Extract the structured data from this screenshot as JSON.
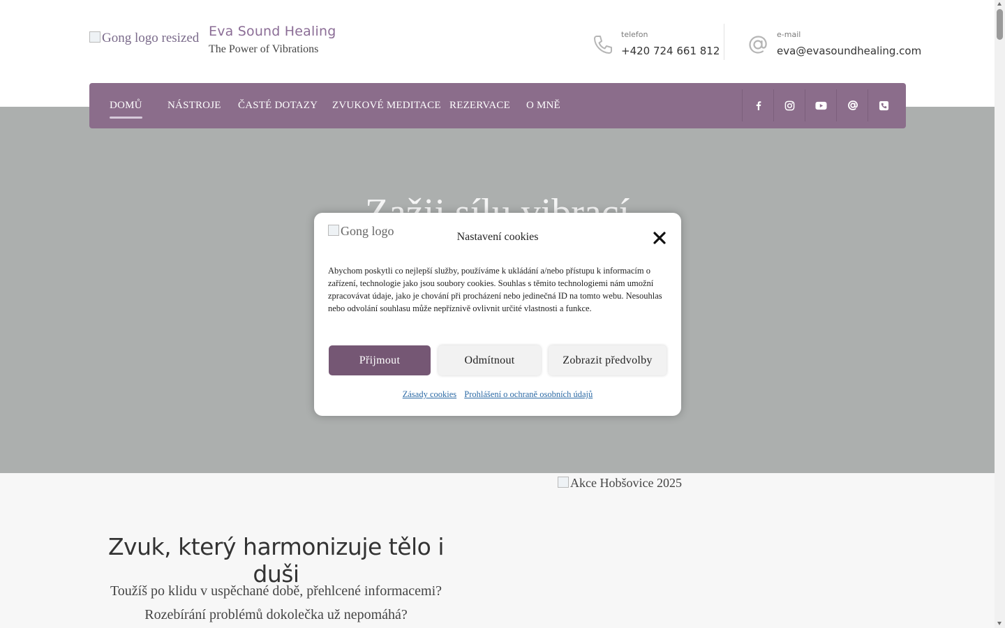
{
  "header": {
    "logo_alt": "Gong logo resized",
    "site_title": "Eva Sound Healing",
    "tagline": "The Power of Vibrations",
    "phone": {
      "label": "telefon",
      "value": "+420 724 661 812",
      "icon": "phone-icon"
    },
    "email": {
      "label": "e-mail",
      "value": "eva@evasoundhealing.com",
      "icon": "at-sign-icon"
    }
  },
  "nav": {
    "items": [
      {
        "label": "DOMŮ",
        "active": true
      },
      {
        "label": "NÁSTROJE"
      },
      {
        "label": "ČASTÉ DOTAZY"
      },
      {
        "label": "ZVUKOVÉ MEDITACE"
      },
      {
        "label": "REZERVACE"
      },
      {
        "label": "O MNĚ"
      }
    ],
    "social": [
      "facebook-icon",
      "instagram-icon",
      "youtube-icon",
      "at-sign-icon",
      "phone-square-icon"
    ]
  },
  "hero": {
    "heading": "Zažij sílu vibrací"
  },
  "cookie_modal": {
    "logo_alt": "Gong logo",
    "title": "Nastavení cookies",
    "body": "Abychom poskytli co nejlepší služby, používáme k ukládání a/nebo přístupu k informacím o zařízení, technologie jako jsou soubory cookies. Souhlas s těmito technologiemi nám umožní zpracovávat údaje, jako je chování při procházení nebo jedinečná ID na tomto webu. Nesouhlas nebo odvolání souhlasu může nepříznivě ovlivnit určité vlastnosti a funkce.",
    "accept_label": "Přijmout",
    "deny_label": "Odmítnout",
    "prefs_label": "Zobrazit předvolby",
    "link_cookies": "Zásady cookies",
    "link_privacy": "Prohlášení o ochraně osobních údajů"
  },
  "section": {
    "event_img_alt": "Akce Hobšovice 2025",
    "heading": "Zvuk, který harmonizuje tělo i duši",
    "line1": "Toužíš po klidu v uspěchané době, přehlcené informacemi?",
    "line2": "Rozebírání problémů dokolečka už nepomáhá?"
  },
  "colors": {
    "accent": "#8b6d8b",
    "button_accept": "#755774",
    "hero_bg": "#acafae",
    "title": "#8b6d96"
  }
}
